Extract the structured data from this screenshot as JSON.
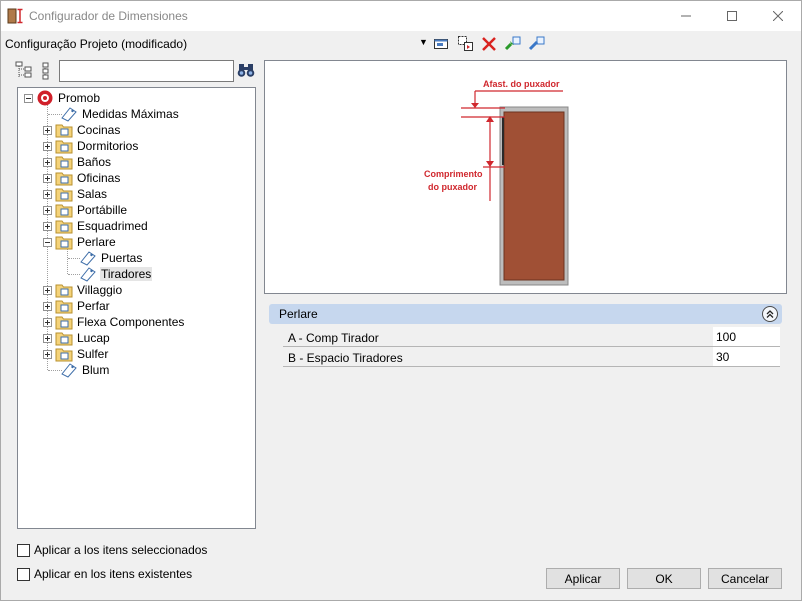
{
  "window": {
    "title": "Configurador de Dimensiones"
  },
  "toolbar": {
    "config_label": "Configuração Projeto (modificado)",
    "icons": [
      "select-window-icon",
      "copy-icon",
      "delete-icon",
      "export-icon",
      "import-icon"
    ]
  },
  "tree_search": {
    "value": "",
    "placeholder": ""
  },
  "tree": {
    "root": "Promob",
    "items": [
      {
        "label": "Medidas Máximas"
      },
      {
        "label": "Cocinas"
      },
      {
        "label": "Dormitorios"
      },
      {
        "label": "Baños"
      },
      {
        "label": "Oficinas"
      },
      {
        "label": "Salas"
      },
      {
        "label": "Portábille"
      },
      {
        "label": "Esquadrimed"
      },
      {
        "label": "Perlare"
      },
      {
        "label": "Puertas"
      },
      {
        "label": "Tiradores"
      },
      {
        "label": "Villaggio"
      },
      {
        "label": "Perfar"
      },
      {
        "label": "Flexa Componentes"
      },
      {
        "label": "Lucap"
      },
      {
        "label": "Sulfer"
      },
      {
        "label": "Blum"
      }
    ]
  },
  "preview": {
    "label_top": "Afast. do puxador",
    "label_side_1": "Comprimento",
    "label_side_2": "do puxador"
  },
  "properties": {
    "section_title": "Perlare",
    "rows": [
      {
        "name": "A -  Comp Tirador",
        "value": "100"
      },
      {
        "name": "B -  Espacio Tiradores",
        "value": "30"
      }
    ]
  },
  "options": {
    "apply_selected": "Aplicar a los itens seleccionados",
    "apply_existing": "Aplicar en los itens existentes"
  },
  "buttons": {
    "apply": "Aplicar",
    "ok": "OK",
    "cancel": "Cancelar"
  },
  "colors": {
    "door_fill": "#a05035",
    "annotation": "#d0282e",
    "section_bg": "#c6d7ee"
  }
}
